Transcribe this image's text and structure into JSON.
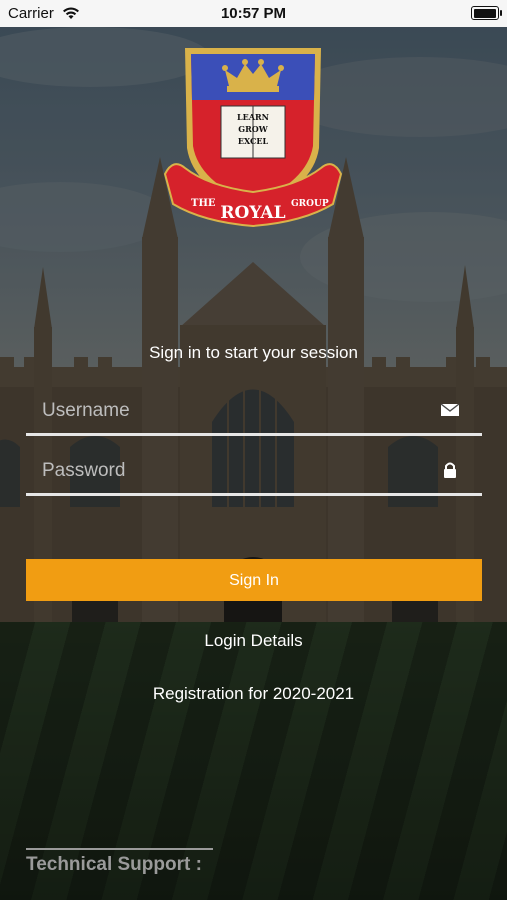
{
  "status_bar": {
    "carrier": "Carrier",
    "time": "10:57 PM"
  },
  "logo": {
    "motto_lines": [
      "LEARN",
      "GROW",
      "EXCEL"
    ],
    "banner_left": "THE",
    "banner_center": "ROYAL",
    "banner_right": "GROUP"
  },
  "login": {
    "subtitle": "Sign in to start your session",
    "username_placeholder": "Username",
    "password_placeholder": "Password",
    "signin_label": "Sign In"
  },
  "links": {
    "login_details": "Login Details",
    "registration": "Registration for 2020-2021"
  },
  "footer": {
    "technical_support": "Technical Support :"
  },
  "icons": {
    "username": "envelope-icon",
    "password": "lock-icon",
    "wifi": "wifi-icon",
    "battery": "battery-icon"
  },
  "colors": {
    "accent": "#f19d12",
    "shield_blue": "#3b4fb8",
    "shield_red": "#d6222b",
    "gold": "#d9b24a"
  }
}
